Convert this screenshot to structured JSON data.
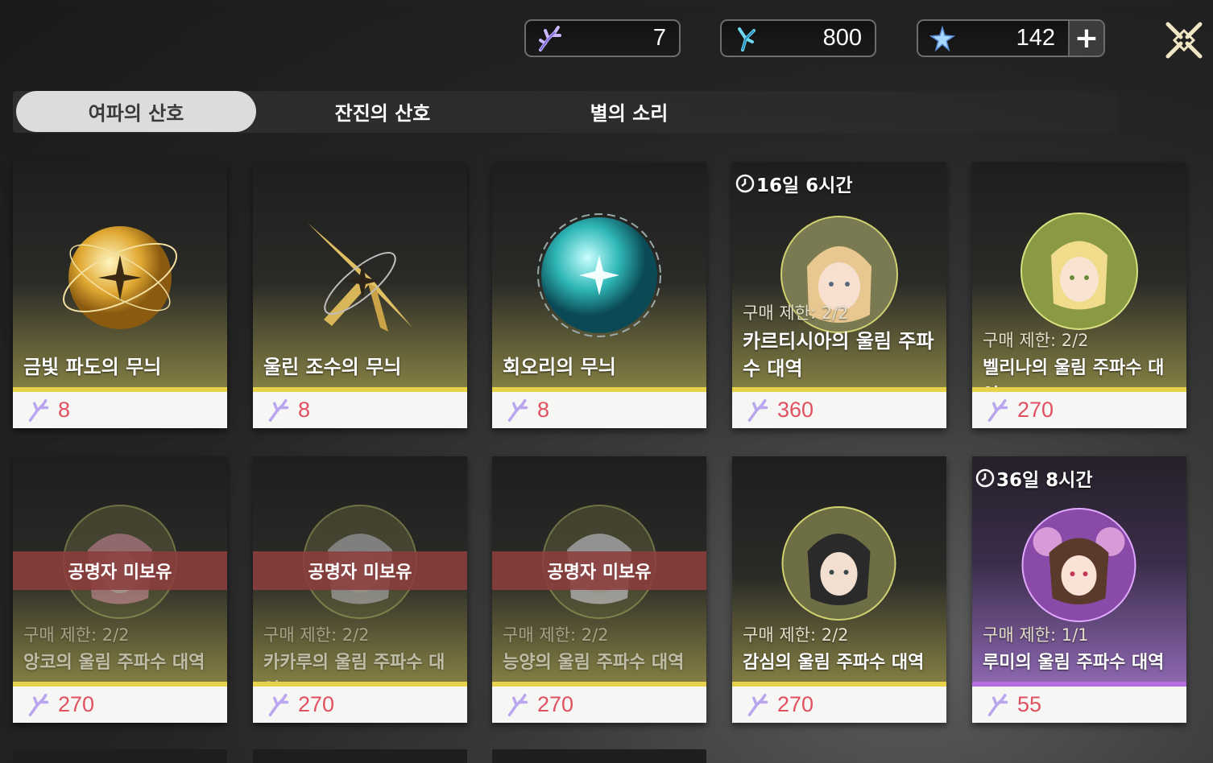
{
  "currency": [
    {
      "icon": "coral-icon",
      "value": "7"
    },
    {
      "icon": "tide-coral-icon",
      "value": "800"
    },
    {
      "icon": "star-crystal-icon",
      "value": "142",
      "plus": "+"
    }
  ],
  "tabs": [
    "여파의 산호",
    "잔진의 산호",
    "별의 소리"
  ],
  "row1": [
    {
      "name": "금빛 파도의 무늬",
      "price": "8"
    },
    {
      "name": "울린 조수의 무늬",
      "price": "8"
    },
    {
      "name": "회오리의 무늬",
      "price": "8"
    },
    {
      "timer": "16일 6시간",
      "limit": "구매 제한: 2/2",
      "name": "카르티시아의 울림 주파수 대역",
      "price": "360"
    },
    {
      "limit": "구매 제한: 2/2",
      "name": "벨리나의 울림 주파수 대역",
      "price": "270"
    }
  ],
  "row2": [
    {
      "banner": "공명자 미보유",
      "limit": "구매 제한: 2/2",
      "name": "앙코의 울림 주파수 대역",
      "price": "270"
    },
    {
      "banner": "공명자 미보유",
      "limit": "구매 제한: 2/2",
      "name": "카카루의 울림 주파수 대역",
      "price": "270"
    },
    {
      "banner": "공명자 미보유",
      "limit": "구매 제한: 2/2",
      "name": "능양의 울림 주파수 대역",
      "price": "270"
    },
    {
      "limit": "구매 제한: 2/2",
      "name": "감심의 울림 주파수 대역",
      "price": "270"
    },
    {
      "timer": "36일 8시간",
      "limit": "구매 제한: 1/1",
      "name": "루미의 울림 주파수 대역",
      "price": "55"
    }
  ],
  "colors": {
    "accent": "#e8d24a",
    "price": "#e05060",
    "limited": "#b66de0",
    "banner": "#8c3e3e"
  }
}
